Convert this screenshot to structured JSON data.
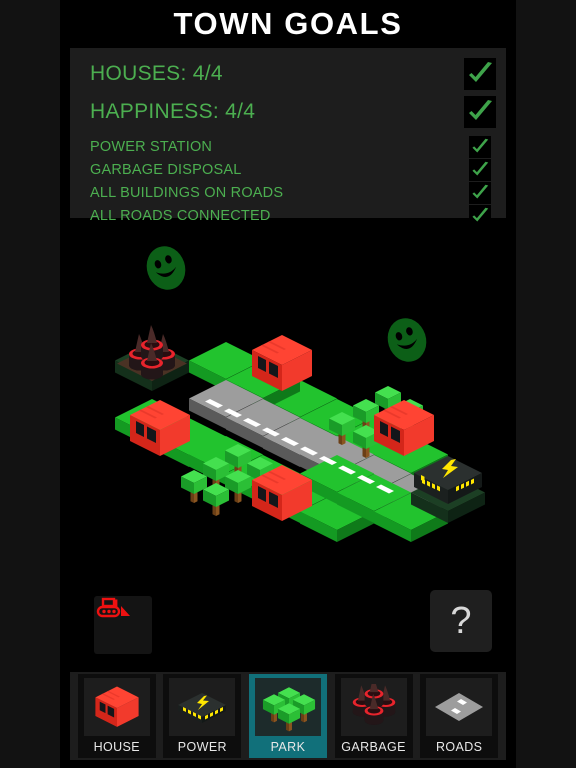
{
  "app": {
    "title": "TOWN GOALS",
    "background_color": "#000000",
    "panel_color": "#1d1d1d",
    "accent_green": "#4caf50",
    "accent_teal": "#11707a",
    "house_red": "#ef3325",
    "power_yellow": "#f5e100"
  },
  "goals": [
    {
      "label": "HOUSES: 4/4",
      "size": "big",
      "checked": true
    },
    {
      "label": "HAPPINESS: 4/4",
      "size": "big",
      "checked": true
    },
    {
      "label": "POWER STATION",
      "size": "small",
      "checked": true
    },
    {
      "label": "GARBAGE DISPOSAL",
      "size": "small",
      "checked": true
    },
    {
      "label": "ALL BUILDINGS ON ROADS",
      "size": "small",
      "checked": true
    },
    {
      "label": "ALL ROADS CONNECTED",
      "size": "small",
      "checked": true
    }
  ],
  "scene": {
    "description": "isometric voxel town",
    "houses": 4,
    "parks": 2,
    "power_stations": 1,
    "garbage_disposals": 1,
    "road_tiles": 6,
    "smileys": 2
  },
  "controls": {
    "demolish_icon": "bulldozer-icon",
    "help_label": "?"
  },
  "toolbar": {
    "items": [
      {
        "label": "HOUSE",
        "icon": "house-icon",
        "selected": false
      },
      {
        "label": "POWER",
        "icon": "power-icon",
        "selected": false
      },
      {
        "label": "PARK",
        "icon": "park-icon",
        "selected": true
      },
      {
        "label": "GARBAGE",
        "icon": "garbage-icon",
        "selected": false
      },
      {
        "label": "ROADS",
        "icon": "roads-icon",
        "selected": false
      }
    ]
  }
}
